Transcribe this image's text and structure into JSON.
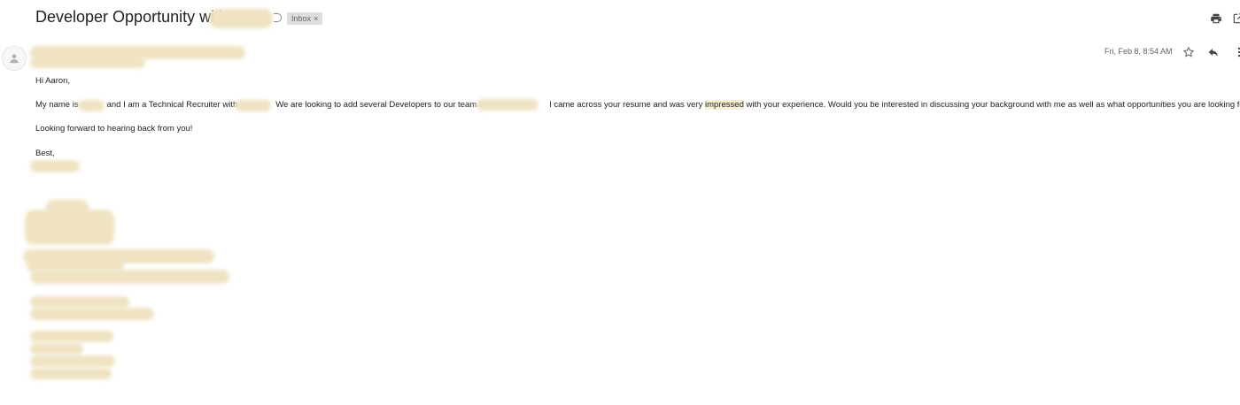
{
  "subject": {
    "text": "Developer Opportunity with",
    "label": "Inbox",
    "label_remove": "×"
  },
  "message": {
    "date": "Fri, Feb 8, 8:54 AM",
    "greeting": "Hi Aaron,",
    "para1_a": "My name is",
    "para1_b": "and I am a Technical Recruiter with",
    "para1_c": "We are looking to add several Developers to our team in",
    "para1_d": "I came across your resume and was very",
    "para1_highlight": "impressed",
    "para1_e": "with your experience. Would you be interested in discussing your background with me as well as what opportunities you are looking for?",
    "para2": "Looking forward to hearing back from you!",
    "signoff": "Best,"
  },
  "icons": {
    "print": "print-icon",
    "open_new": "open-in-new-window-icon",
    "star": "star-icon",
    "reply": "reply-icon",
    "more": "more-vertical-icon",
    "avatar": "person-icon"
  },
  "colors": {
    "redaction": "#efe3c2",
    "chip_bg": "#dddddd",
    "highlight": "#f6efd2"
  }
}
